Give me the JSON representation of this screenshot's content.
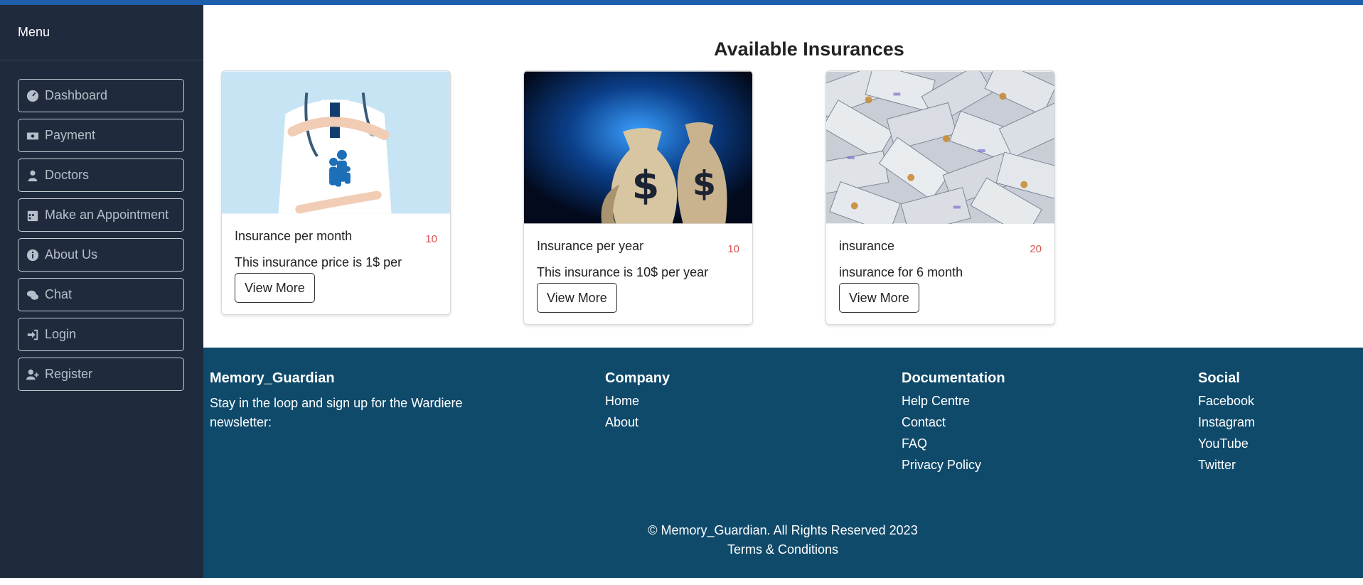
{
  "sidebar": {
    "title": "Menu",
    "items": [
      {
        "label": "Dashboard",
        "icon": "dashboard-icon"
      },
      {
        "label": "Payment",
        "icon": "money-icon"
      },
      {
        "label": "Doctors",
        "icon": "doctor-icon"
      },
      {
        "label": "Make an Appointment",
        "icon": "calendar-icon"
      },
      {
        "label": "About Us",
        "icon": "info-icon"
      },
      {
        "label": "Chat",
        "icon": "chat-icon"
      },
      {
        "label": "Login",
        "icon": "login-icon"
      },
      {
        "label": "Register",
        "icon": "user-plus-icon"
      }
    ]
  },
  "main": {
    "title": "Available Insurances",
    "cards": [
      {
        "title": "Insurance per month",
        "count": "10",
        "text": "This insurance price is 1$ per",
        "button": "View More",
        "image": "doctor-family-protection-image"
      },
      {
        "title": "Insurance per year",
        "count": "10",
        "text": "This insurance is 10$ per year",
        "button": "View More",
        "image": "money-bags-image"
      },
      {
        "title": "insurance",
        "count": "20",
        "text": "insurance for 6 month",
        "button": "View More",
        "image": "dollar-bills-image"
      }
    ]
  },
  "footer": {
    "brand": {
      "title": "Memory_Guardian",
      "text": "Stay in the loop and sign up for the Wardiere newsletter:"
    },
    "company": {
      "title": "Company",
      "links": [
        "Home",
        "About"
      ]
    },
    "documentation": {
      "title": "Documentation",
      "links": [
        "Help Centre",
        "Contact",
        "FAQ",
        "Privacy Policy"
      ]
    },
    "social": {
      "title": "Social",
      "links": [
        "Facebook",
        "Instagram",
        "YouTube",
        "Twitter"
      ]
    },
    "copyright": "© Memory_Guardian. All Rights Reserved 2023",
    "terms": "Terms & Conditions"
  },
  "colors": {
    "topbar": "#1e5eab",
    "sidebar": "#1f2a3c",
    "footer": "#0f4a6b",
    "count": "#d9534f"
  }
}
